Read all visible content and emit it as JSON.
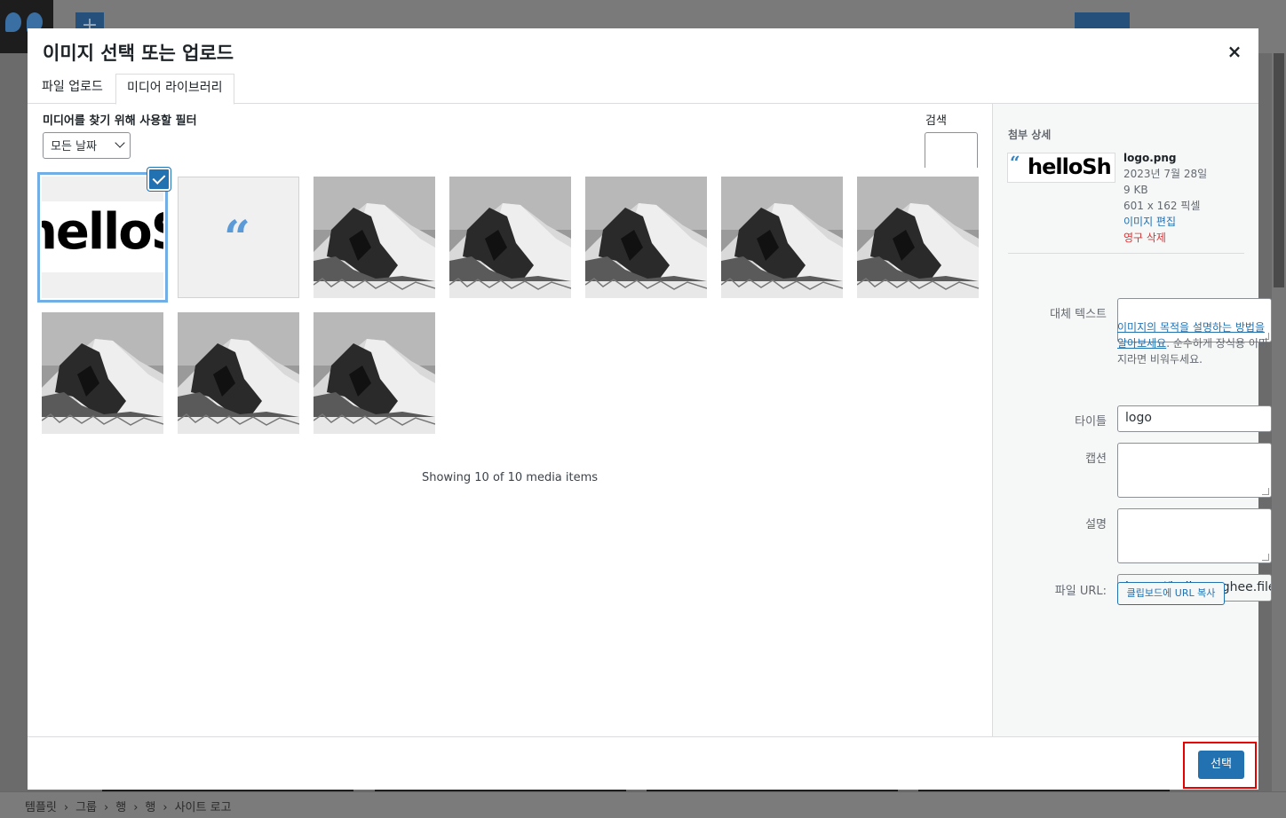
{
  "modal": {
    "title": "이미지 선택 또는 업로드",
    "close_icon": "×",
    "tabs": [
      {
        "label": "파일 업로드"
      },
      {
        "label": "미디어 라이브러리"
      }
    ]
  },
  "filters": {
    "label": "미디어를 찾기 위해 사용할 필터",
    "date_selected": "모든 날짜",
    "search_label": "검색"
  },
  "grid": {
    "items": [
      {
        "kind": "logo-wide",
        "text": "helloS",
        "selected": true
      },
      {
        "kind": "logo-quote",
        "text": "“"
      },
      {
        "kind": "mountain"
      },
      {
        "kind": "mountain"
      },
      {
        "kind": "mountain"
      },
      {
        "kind": "mountain"
      },
      {
        "kind": "mountain"
      },
      {
        "kind": "mountain"
      },
      {
        "kind": "mountain"
      },
      {
        "kind": "mountain"
      }
    ],
    "showing": "Showing 10 of 10 media items"
  },
  "details": {
    "title": "첨부 상세",
    "thumb_quote": "“",
    "thumb_text": "helloSh",
    "filename": "logo.png",
    "date": "2023년 7월 28일",
    "size": "9 KB",
    "dimensions": "601 x 162 픽셀",
    "edit_link": "이미지 편집",
    "delete_link": "영구 삭제",
    "alt_label": "대체 텍스트",
    "alt_value": "",
    "help_link": "이미지의 목적을 설명하는 방법을 알아보세요",
    "help_text": ". 순수하게 장식용 이미지라면 비워두세요.",
    "title_label": "타이틀",
    "title_value": "logo",
    "caption_label": "캡션",
    "caption_value": "",
    "desc_label": "설명",
    "desc_value": "",
    "url_label": "파일 URL:",
    "url_value": "https://hellosanghee.files.w",
    "copy_button": "클립보드에 URL 복사"
  },
  "footer": {
    "select_button": "선택"
  },
  "breadcrumb": [
    "템플릿",
    "›",
    "그룹",
    "›",
    "행",
    "›",
    "행",
    "›",
    "사이트 로고"
  ]
}
